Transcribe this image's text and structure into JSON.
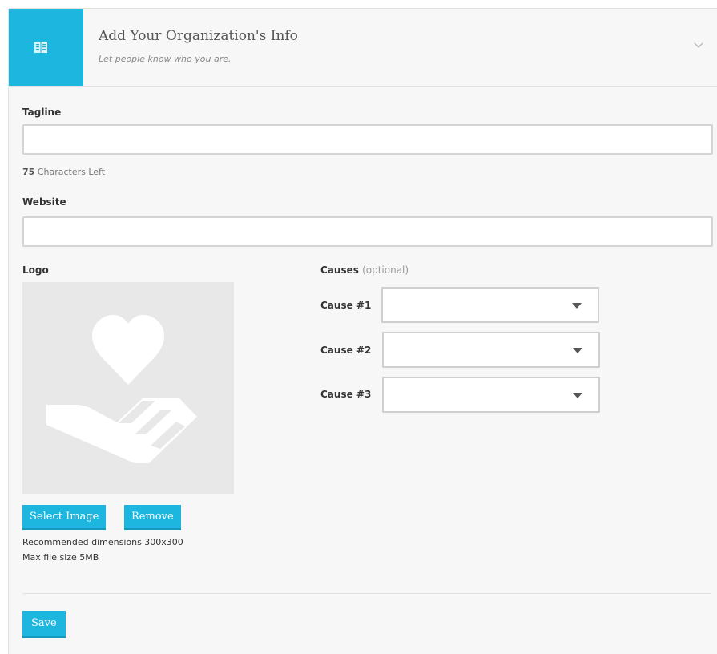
{
  "header": {
    "title": "Add Your Organization's Info",
    "subtitle": "Let people know who you are.",
    "accent_color": "#1cb6df",
    "icon": "book-icon",
    "toggle_icon": "chevron-down-icon"
  },
  "tagline": {
    "label": "Tagline",
    "value": "",
    "chars_left": "75",
    "chars_left_suffix": " Characters Left"
  },
  "website": {
    "label": "Website",
    "value": ""
  },
  "logo": {
    "label": "Logo",
    "placeholder_icon": "heart-hand-icon",
    "select_button": "Select Image",
    "remove_button": "Remove",
    "recommended": "Recommended dimensions 300x300",
    "max_size": "Max file size 5MB"
  },
  "causes": {
    "title": "Causes",
    "optional": "(optional)",
    "items": [
      {
        "label": "Cause #1",
        "value": ""
      },
      {
        "label": "Cause #2",
        "value": ""
      },
      {
        "label": "Cause #3",
        "value": ""
      }
    ]
  },
  "actions": {
    "save": "Save"
  }
}
